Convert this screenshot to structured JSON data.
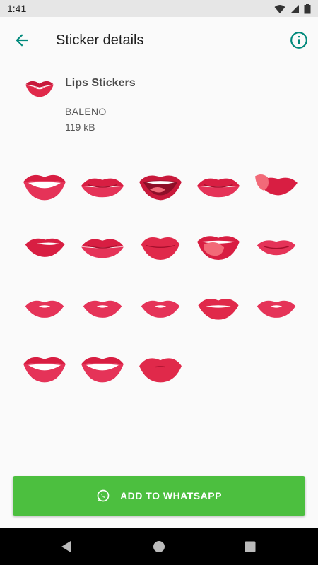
{
  "status_bar": {
    "time": "1:41",
    "icons": [
      "wifi-icon",
      "signal-icon",
      "battery-icon"
    ]
  },
  "app_bar": {
    "title": "Sticker details",
    "back_icon": "arrow-back-icon",
    "info_icon": "info-icon"
  },
  "pack": {
    "name": "Lips Stickers",
    "publisher": "BALENO",
    "size": "119 kB"
  },
  "stickers": [
    "lips-smile-teeth",
    "lips-closed",
    "lips-smile-tongue",
    "lips-closed",
    "lips-lick",
    "lips-bite",
    "lips-closed",
    "lips-pout",
    "lips-tongue-out",
    "lips-pout-small",
    "lips-kiss-small",
    "lips-kiss-small",
    "lips-kiss-small",
    "lips-parted",
    "lips-kiss-small",
    "lips-smile-teeth",
    "lips-smile-teeth",
    "lips-kiss"
  ],
  "actions": {
    "add_label": "ADD TO WHATSAPP",
    "add_icon": "whatsapp-icon"
  },
  "nav_bar": {
    "icons": [
      "back-triangle-icon",
      "home-circle-icon",
      "recents-square-icon"
    ]
  },
  "colors": {
    "accent": "#00897b",
    "button": "#4cbf3f",
    "lips": "#e0294a"
  }
}
